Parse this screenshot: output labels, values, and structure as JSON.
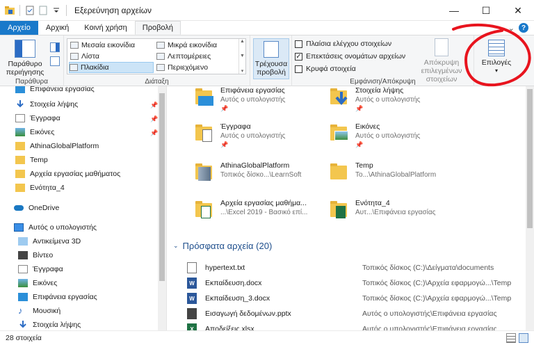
{
  "window": {
    "title": "Εξερεύνηση αρχείων",
    "qa_icons": [
      "folder-icon",
      "properties-icon",
      "new-folder-icon",
      "dropdown-icon"
    ],
    "controls": {
      "minimize": "—",
      "maximize": "☐",
      "close": "✕"
    }
  },
  "tabs": {
    "file": "Αρχείο",
    "home": "Αρχική",
    "share": "Κοινή χρήση",
    "view": "Προβολή",
    "right_chevron": "⌄",
    "help": "?"
  },
  "ribbon": {
    "panes": {
      "preview_label": "Παράθυρο περιήγησης",
      "group_label": "Παράθυρα"
    },
    "layout": {
      "group_label": "Διάταξη",
      "items": [
        "Μεσαία εικονίδια",
        "Μικρά εικονίδια",
        "Λίστα",
        "Λεπτομέρειες",
        "Πλακίδια",
        "Περιεχόμενο"
      ],
      "selected": "Πλακίδια"
    },
    "current_view": {
      "label": "Τρέχουσα προβολή"
    },
    "show_hide": {
      "group_label": "Εμφάνιση/Απόκρυψη",
      "checkboxes": [
        {
          "label": "Πλαίσια ελέγχου στοιχείων",
          "checked": false
        },
        {
          "label": "Επεκτάσεις ονομάτων αρχείων",
          "checked": true
        },
        {
          "label": "Κρυφά στοιχεία",
          "checked": false
        }
      ],
      "hide_selected": "Απόκρυψη επιλεγμένων στοιχείων"
    },
    "options": {
      "label": "Επιλογές"
    }
  },
  "nav": {
    "items": [
      "Επιφάνεια εργασίας",
      "Στοιχεία λήψης",
      "Έγγραφα",
      "Εικόνες",
      "AthinaGlobalPlatform",
      "Temp",
      "Αρχεία εργασίας μαθήματος",
      "Ενότητα_4",
      "OneDrive",
      "Αυτός ο υπολογιστής",
      "Αντικείμενα 3D",
      "Βίντεο",
      "Έγγραφα",
      "Εικόνες",
      "Επιφάνεια εργασίας",
      "Μουσική",
      "Στοιχεία λήψης"
    ]
  },
  "main": {
    "tiles": [
      {
        "name": "Επιφάνεια εργασίας",
        "sub": "Αυτός ο υπολογιστής"
      },
      {
        "name": "Στοιχεία λήψης",
        "sub": "Αυτός ο υπολογιστής"
      },
      {
        "name": "Έγγραφα",
        "sub": "Αυτός ο υπολογιστής"
      },
      {
        "name": "Εικόνες",
        "sub": "Αυτός ο υπολογιστής"
      },
      {
        "name": "AthinaGlobalPlatform",
        "sub": "Τοπικός δίσκο...\\LearnSoft"
      },
      {
        "name": "Temp",
        "sub": "Το...\\AthinaGlobalPlatform"
      },
      {
        "name": "Αρχεία εργασίας μαθήμα...",
        "sub": "...\\Excel 2019 - Βασικό επί..."
      },
      {
        "name": "Ενότητα_4",
        "sub": "Αυτ...\\Επιφάνεια εργασίας"
      }
    ],
    "recent_header": "Πρόσφατα αρχεία (20)",
    "recent": [
      {
        "name": "hypertext.txt",
        "path": "Τοπικός δίσκος (C:)\\Δείγματα\\documents"
      },
      {
        "name": "Εκπαίδευση.docx",
        "path": "Τοπικός δίσκος (C:)\\Αρχεία εφαρμογώ...\\Temp"
      },
      {
        "name": "Εκπαίδευση_3.docx",
        "path": "Τοπικός δίσκος (C:)\\Αρχεία εφαρμογώ...\\Temp"
      },
      {
        "name": "Εισαγωγή δεδομένων.pptx",
        "path": "Αυτός ο υπολογιστής\\Επιφάνεια εργασίας"
      },
      {
        "name": "Αποδείξεις.xlsx",
        "path": "Αυτός ο υπολογιστής\\Επιφάνεια εργασίας"
      }
    ]
  },
  "status": {
    "count": "28 στοιχεία"
  },
  "colors": {
    "accent": "#1979ca",
    "annotation": "#e8141e",
    "folder": "#f3c64e"
  }
}
